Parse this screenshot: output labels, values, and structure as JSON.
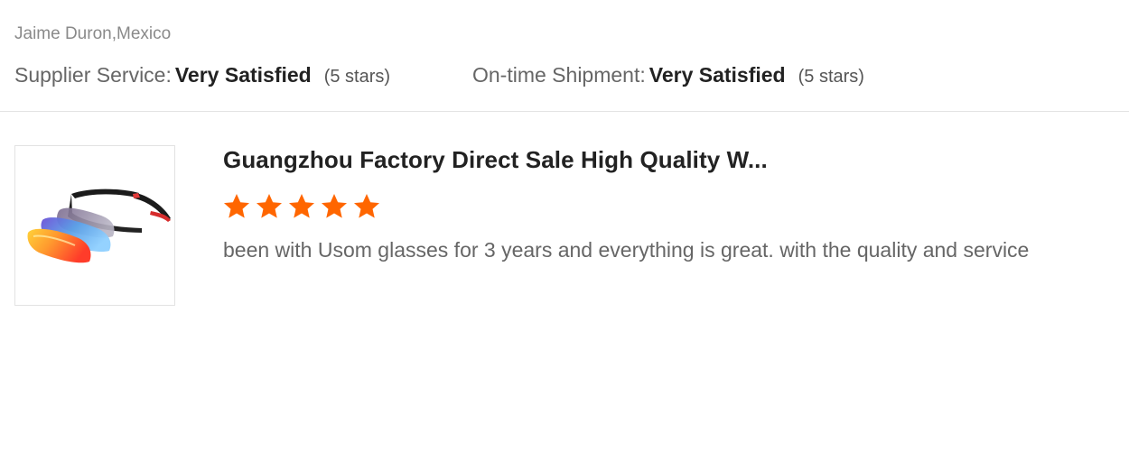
{
  "reviewer": {
    "name_location": "Jaime Duron,Mexico"
  },
  "ratings": {
    "supplier_service": {
      "label": "Supplier Service:",
      "value": "Very Satisfied",
      "stars_note": "(5 stars)"
    },
    "on_time_shipment": {
      "label": "On-time Shipment:",
      "value": "Very Satisfied",
      "stars_note": "(5 stars)"
    }
  },
  "product": {
    "title": "Guangzhou Factory Direct Sale High Quality W...",
    "rating_stars": 5,
    "star_color": "#ff6600",
    "image_icon": "sunglasses-product-image"
  },
  "review": {
    "text": "been with Usom glasses for 3 years and everything is great. with the quality and service"
  }
}
